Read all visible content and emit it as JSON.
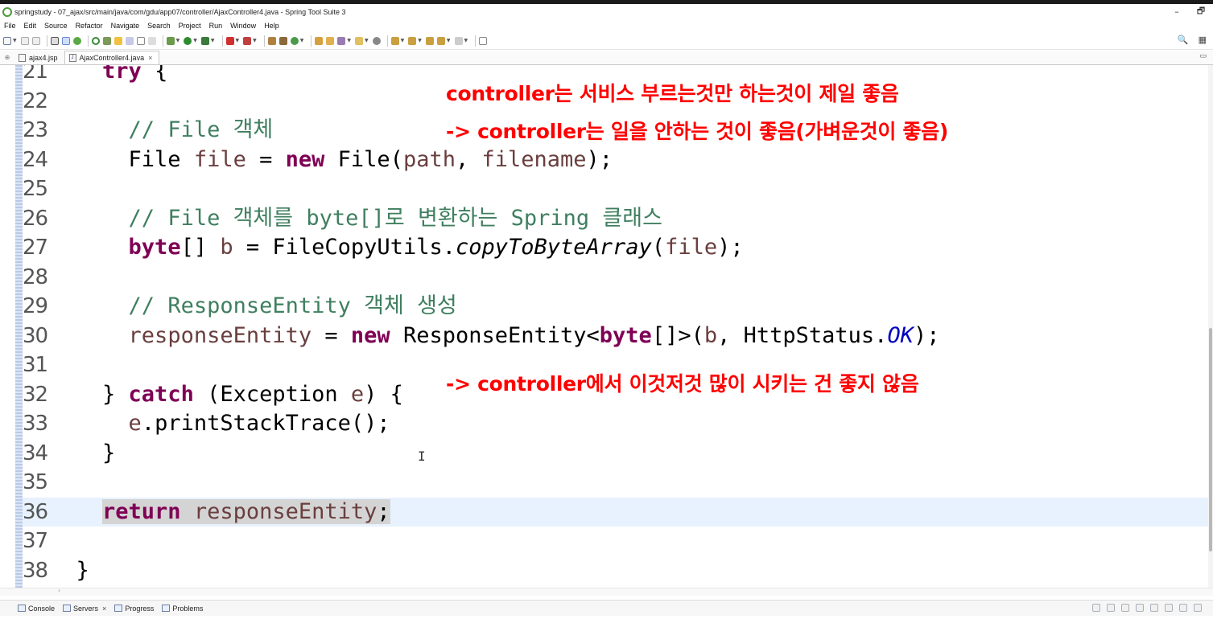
{
  "window": {
    "title": "springstudy - 07_ajax/src/main/java/com/gdu/app07/controller/AjaxController4.java - Spring Tool Suite 3",
    "minimize": "–",
    "maximize": "🗗",
    "close": "✕"
  },
  "menu": [
    "File",
    "Edit",
    "Source",
    "Refactor",
    "Navigate",
    "Search",
    "Project",
    "Run",
    "Window",
    "Help"
  ],
  "editor_tabs": [
    {
      "label": "ajax4.jsp",
      "active": false
    },
    {
      "label": "AjaxController4.java",
      "active": true,
      "close": "×"
    }
  ],
  "code": {
    "lines": [
      {
        "num": "21",
        "text": "    try {"
      },
      {
        "num": "22",
        "text": ""
      },
      {
        "num": "23",
        "text": "      // File 객체"
      },
      {
        "num": "24",
        "text": "      File file = new File(path, filename);"
      },
      {
        "num": "25",
        "text": ""
      },
      {
        "num": "26",
        "text": "      // File 객체를 byte[]로 변환하는 Spring 클래스"
      },
      {
        "num": "27",
        "text": "      byte[] b = FileCopyUtils.copyToByteArray(file);"
      },
      {
        "num": "28",
        "text": ""
      },
      {
        "num": "29",
        "text": "      // ResponseEntity 객체 생성"
      },
      {
        "num": "30",
        "text": "      responseEntity = new ResponseEntity<byte[]>(b, HttpStatus.OK);"
      },
      {
        "num": "31",
        "text": ""
      },
      {
        "num": "32",
        "text": "    } catch (Exception e) {"
      },
      {
        "num": "33",
        "text": "      e.printStackTrace();"
      },
      {
        "num": "34",
        "text": "    }"
      },
      {
        "num": "35",
        "text": ""
      },
      {
        "num": "36",
        "text": "    return responseEntity;"
      },
      {
        "num": "37",
        "text": ""
      },
      {
        "num": "38",
        "text": "  }"
      }
    ],
    "current_line": "36"
  },
  "annotations": {
    "line1": "controller는 서비스 부르는것만 하는것이 제일 좋음",
    "line2": "-> controller는 일을 안하는 것이 좋음(가벼운것이 좋음)",
    "line3": "-> controller에서 이것저것 많이 시키는 건 좋지 않음"
  },
  "bottom_tabs": [
    {
      "label": "Console"
    },
    {
      "label": "Servers",
      "close": "×"
    },
    {
      "label": "Progress"
    },
    {
      "label": "Problems"
    }
  ],
  "colors": {
    "keyword": "#7f0055",
    "comment": "#3f7f5f",
    "variable": "#6a3e3e",
    "static_field": "#0000c0",
    "annotation": "#ff0000",
    "current_line": "#e8f2fe"
  },
  "icons": {
    "cursor": "I"
  }
}
